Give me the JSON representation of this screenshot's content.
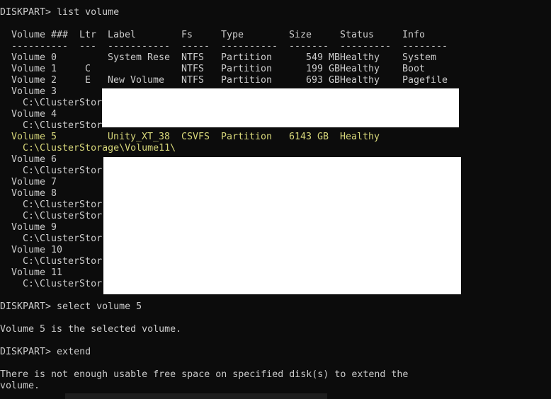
{
  "terminal": {
    "colors": {
      "background": "#0c0c0c",
      "text": "#cccccc",
      "selected_row": "#d7d77a",
      "redaction": "#ffffff"
    },
    "command1": "DISKPART> list volume",
    "table": {
      "headers": [
        "Volume ###",
        "Ltr",
        "Label",
        "Fs",
        "Type",
        "Size",
        "Status",
        "Info"
      ],
      "separators": [
        "----------",
        "---",
        "-----------",
        "-----",
        "----------",
        "-------",
        "---------",
        "--------"
      ],
      "rows": [
        [
          "Volume 0",
          "",
          "System Rese",
          "NTFS",
          "Partition",
          "549 MB",
          "Healthy",
          "System"
        ],
        [
          "Volume 1",
          "C",
          "",
          "NTFS",
          "Partition",
          "199 GB",
          "Healthy",
          "Boot"
        ],
        [
          "Volume 2",
          "E",
          "New Volume",
          "NTFS",
          "Partition",
          "693 GB",
          "Healthy",
          "Pagefile"
        ]
      ],
      "volume3": "Volume 3",
      "path3": "C:\\ClusterStor",
      "volume4": "Volume 4",
      "path4": "C:\\ClusterStor",
      "selected_row": [
        "Volume 5",
        "Unity_XT_38",
        "CSVFS",
        "Partition",
        "6143 GB",
        "Healthy"
      ],
      "selected_path": "C:\\ClusterStorage\\Volume11\\",
      "volume6": "Volume 6",
      "path6": "C:\\ClusterStor",
      "volume7": "Volume 7",
      "volume8": "Volume 8",
      "path8a": "C:\\ClusterStor",
      "path8b": "C:\\ClusterStor",
      "volume9": "Volume 9",
      "path9": "C:\\ClusterStor",
      "volume10": "Volume 10",
      "path10": "C:\\ClusterStor",
      "volume11": "Volume 11",
      "path11": "C:\\ClusterStor"
    },
    "command2": "DISKPART> select volume 5",
    "response2": "Volume 5 is the selected volume.",
    "command3": "DISKPART> extend",
    "response3_line1": "There is not enough usable free space on specified disk(s) to extend the",
    "response3_line2": "volume."
  }
}
